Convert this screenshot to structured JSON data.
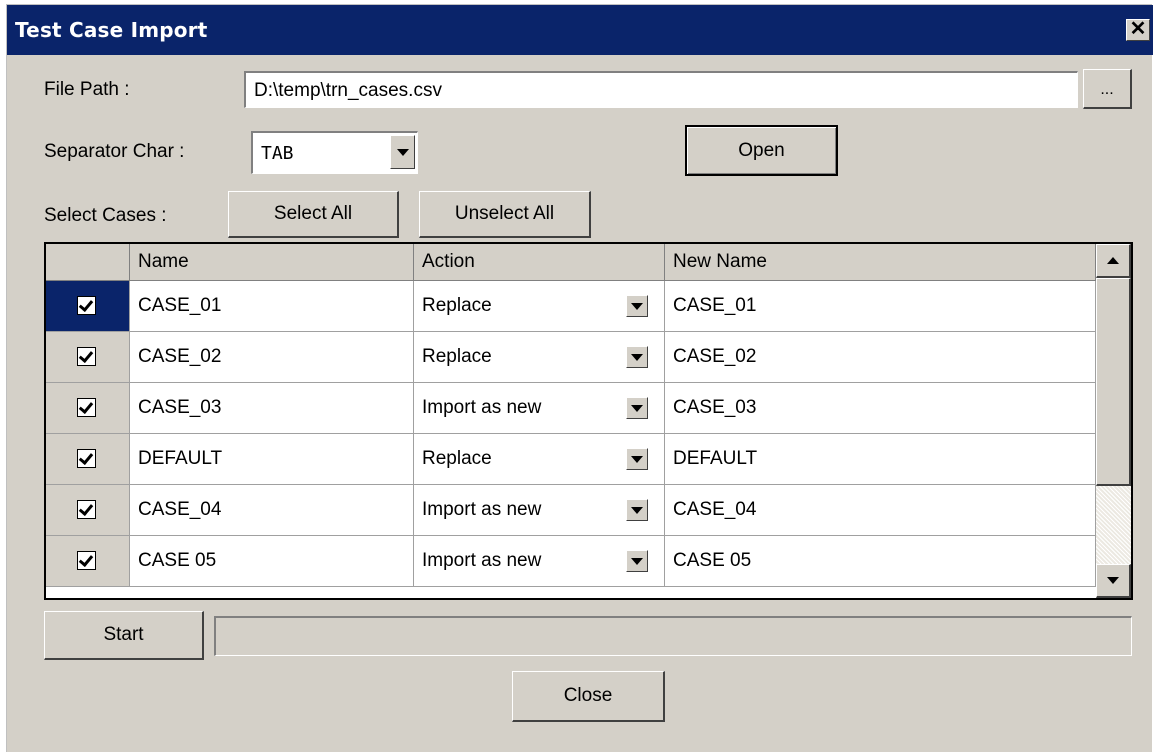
{
  "window": {
    "title": "Test Case Import",
    "close_glyph": "✕"
  },
  "file_path": {
    "label": "File Path :",
    "value": "D:\\temp\\trn_cases.csv",
    "browse_label": "..."
  },
  "separator": {
    "label": "Separator Char :",
    "value": "TAB"
  },
  "open_label": "Open",
  "select_cases": {
    "label": "Select Cases :",
    "select_all": "Select All",
    "unselect_all": "Unselect All"
  },
  "grid": {
    "columns": [
      "",
      "Name",
      "Action",
      "New Name"
    ],
    "rows": [
      {
        "checked": true,
        "name": "CASE_01",
        "action": "Replace",
        "new_name": "CASE_01",
        "selected": true
      },
      {
        "checked": true,
        "name": "CASE_02",
        "action": "Replace",
        "new_name": "CASE_02",
        "selected": false
      },
      {
        "checked": true,
        "name": "CASE_03",
        "action": "Import as new",
        "new_name": "CASE_03",
        "selected": false
      },
      {
        "checked": true,
        "name": "DEFAULT",
        "action": "Replace",
        "new_name": "DEFAULT",
        "selected": false
      },
      {
        "checked": true,
        "name": "CASE_04",
        "action": "Import as new",
        "new_name": "CASE_04",
        "selected": false
      },
      {
        "checked": true,
        "name": "CASE 05",
        "action": "Import as new",
        "new_name": "CASE 05",
        "selected": false
      }
    ]
  },
  "start_label": "Start",
  "progress": 0,
  "close_label": "Close",
  "colors": {
    "titlebar": "#0a246a",
    "dialog_bg": "#d4d0c8",
    "selected_row": "#0a246a"
  },
  "icons": {
    "close": "close-icon",
    "dropdown": "chevron-down-icon",
    "scroll_up": "scroll-up-icon",
    "scroll_down": "scroll-down-icon",
    "checkbox": "checkbox-checked-icon"
  }
}
